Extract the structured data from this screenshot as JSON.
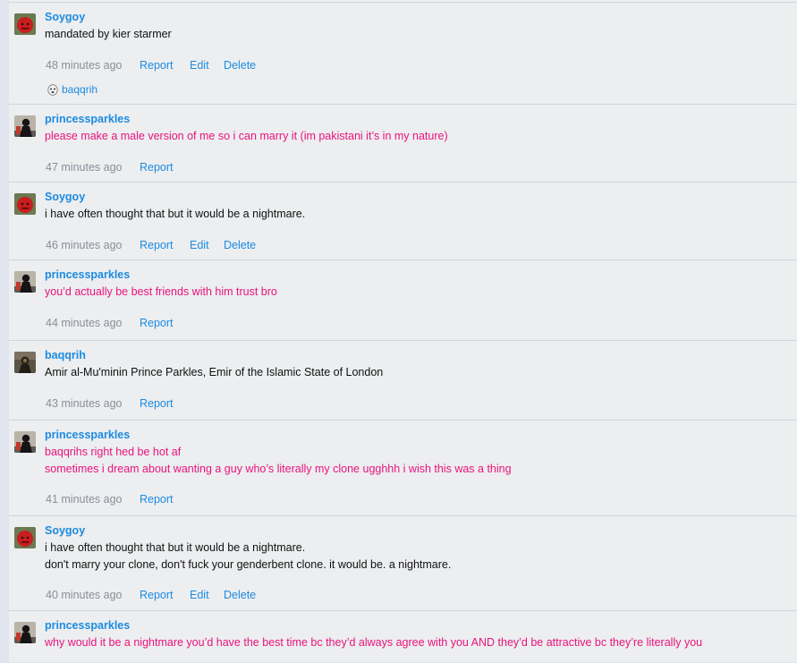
{
  "comments": [
    {
      "author": "Soygoy",
      "avatar": "red-devil-avatar",
      "lines": [
        "mandated by kier starmer"
      ],
      "pink": false,
      "time": "48 minutes ago",
      "actions": [
        "Report",
        "Edit",
        "Delete"
      ],
      "reaction": {
        "icon": "ghost-face-icon",
        "user": "baqqrih"
      }
    },
    {
      "author": "princessparkles",
      "avatar": "masked-figure-avatar",
      "lines": [
        "please make a male version of me so i can marry it (im pakistani it’s in my nature)"
      ],
      "pink": true,
      "time": "47 minutes ago",
      "actions": [
        "Report"
      ]
    },
    {
      "author": "Soygoy",
      "avatar": "red-devil-avatar",
      "lines": [
        "i have often thought that but it would be a nightmare."
      ],
      "pink": false,
      "time": "46 minutes ago",
      "actions": [
        "Report",
        "Edit",
        "Delete"
      ]
    },
    {
      "author": "princessparkles",
      "avatar": "masked-figure-avatar",
      "lines": [
        "you’d actually be best friends with him trust bro"
      ],
      "pink": true,
      "time": "44 minutes ago",
      "actions": [
        "Report"
      ]
    },
    {
      "author": "baqqrih",
      "avatar": "dark-portrait-avatar",
      "lines": [
        "Amir al-Mu'minin Prince Parkles, Emir of the Islamic State of London"
      ],
      "pink": false,
      "time": "43 minutes ago",
      "actions": [
        "Report"
      ]
    },
    {
      "author": "princessparkles",
      "avatar": "masked-figure-avatar",
      "lines": [
        "baqqrihs right hed be hot af",
        "sometimes i dream about wanting a guy who’s literally my clone ugghhh i wish this was a thing"
      ],
      "pink": true,
      "time": "41 minutes ago",
      "actions": [
        "Report"
      ]
    },
    {
      "author": "Soygoy",
      "avatar": "red-devil-avatar",
      "lines": [
        "i have often thought that but it would be a nightmare.",
        "don't marry your clone, don't fuck your genderbent clone. it would be. a nightmare."
      ],
      "pink": false,
      "time": "40 minutes ago",
      "actions": [
        "Report",
        "Edit",
        "Delete"
      ]
    },
    {
      "author": "princessparkles",
      "avatar": "masked-figure-avatar",
      "lines": [
        "why would it be a nightmare you’d have the best time bc they’d always agree with you AND they’d be attractive bc they’re literally you"
      ],
      "pink": true,
      "time": "",
      "actions": []
    }
  ],
  "colors": {
    "link": "#1d8be0",
    "pink_text": "#e9137e",
    "meta": "#8a8f99",
    "background": "#eceef0"
  }
}
